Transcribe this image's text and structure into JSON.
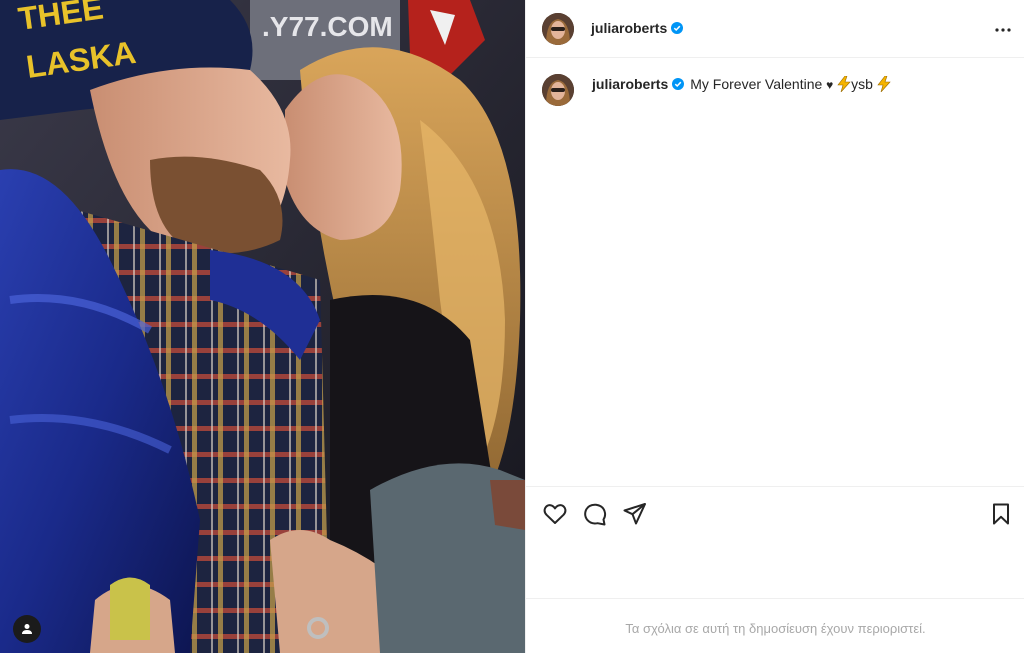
{
  "post": {
    "image_alt": "Couple kissing photo",
    "image_sign_text": ".Y77.COM",
    "hat_text_line1": "THEE",
    "hat_text_line2": "LASKA"
  },
  "header": {
    "username": "juliaroberts",
    "verified": true,
    "more_icon": "more-horizontal-icon"
  },
  "caption": {
    "username": "juliaroberts",
    "text_before": "My Forever Valentine ",
    "heart": "♥",
    "text_mid": "ysb"
  },
  "actions": {
    "like_icon": "heart-icon",
    "comment_icon": "comment-icon",
    "share_icon": "share-icon",
    "save_icon": "bookmark-icon"
  },
  "footer": {
    "comments_restricted": "Τα σχόλια σε αυτή τη δημοσίευση έχουν περιοριστεί."
  },
  "colors": {
    "verified_blue": "#0095f6",
    "divider": "#efefef",
    "muted_text": "#a8a8a8",
    "bolt_yellow": "#f5b400"
  }
}
